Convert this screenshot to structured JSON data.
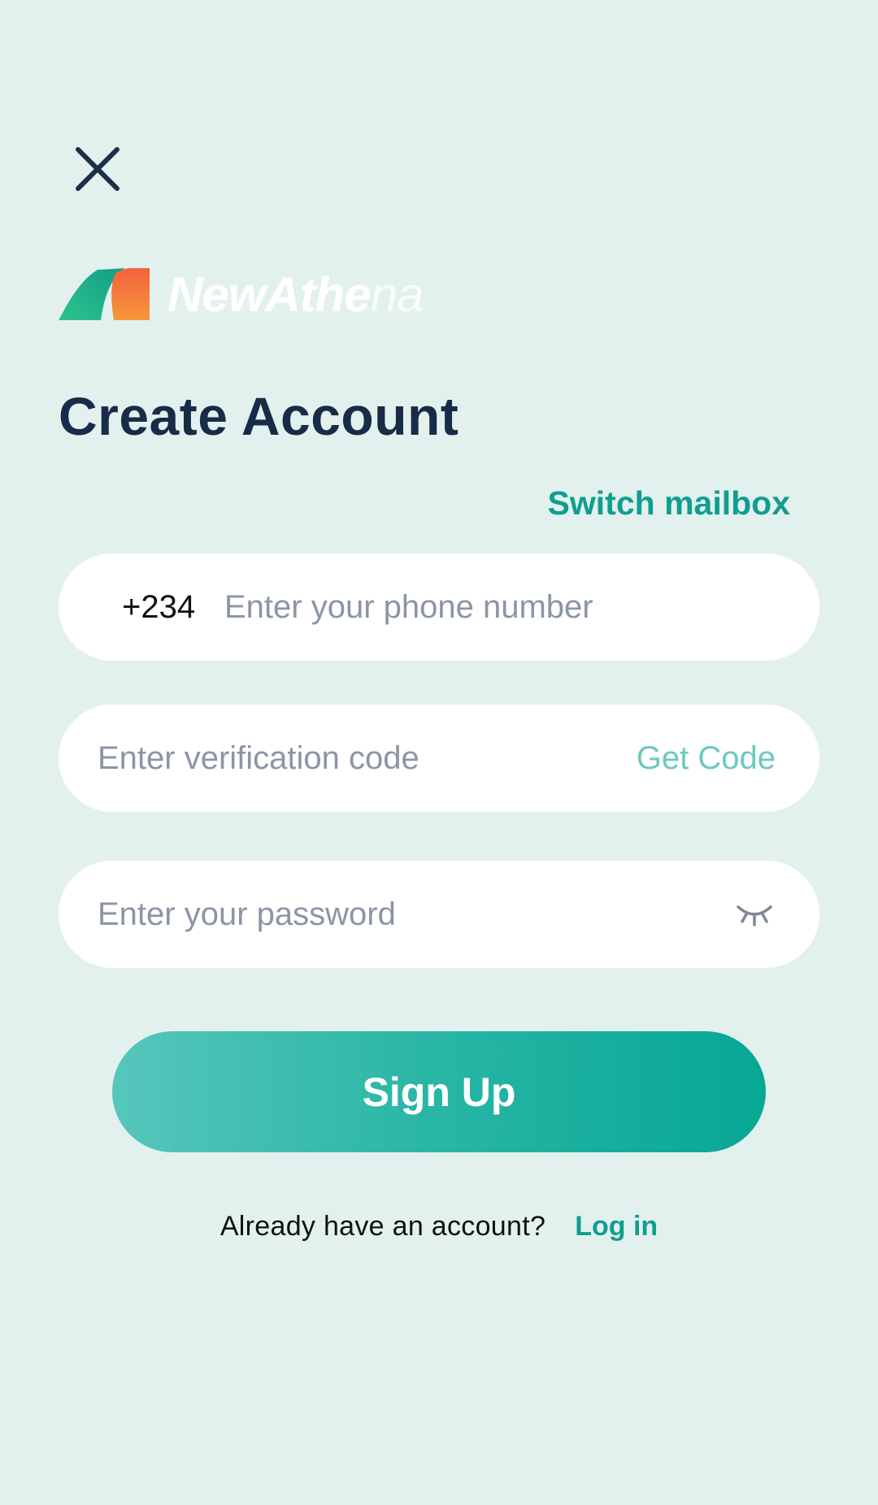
{
  "header": {
    "close_icon": "close-icon"
  },
  "brand": {
    "logo_icon": "newathena-logo-mark",
    "name_part1": "NewAthe",
    "name_part2": "na",
    "colors": {
      "green": "#1ab08f",
      "orange": "#f5833b"
    }
  },
  "page": {
    "title": "Create Account"
  },
  "switch_mode": {
    "label": "Switch mailbox"
  },
  "form": {
    "phone": {
      "country_code": "+234",
      "placeholder": "Enter your phone number",
      "value": ""
    },
    "code": {
      "placeholder": "Enter verification code",
      "value": "",
      "get_code_label": "Get Code"
    },
    "password": {
      "placeholder": "Enter your password",
      "value": "",
      "toggle_icon": "eye-closed-icon"
    },
    "submit_label": "Sign Up"
  },
  "footer": {
    "prompt": "Already have an account?",
    "login_label": "Log in"
  },
  "colors": {
    "background": "#e3f1ee",
    "accent": "#0f9e90",
    "title": "#182b47",
    "placeholder": "#8b95a5"
  }
}
